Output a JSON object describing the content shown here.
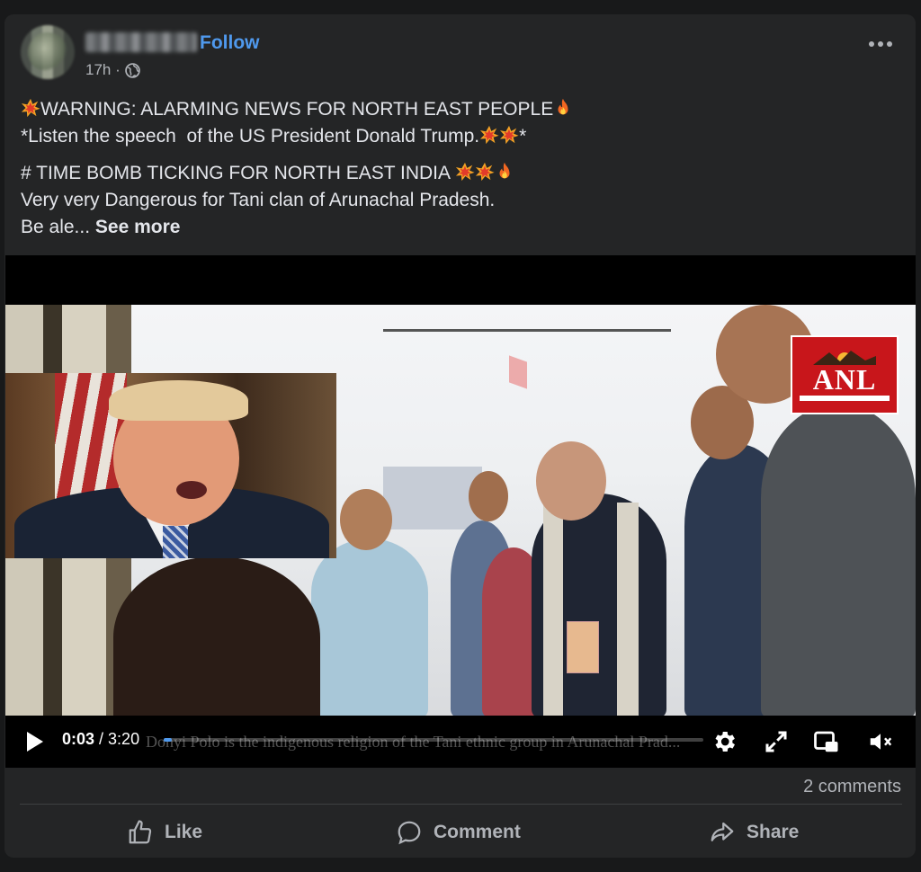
{
  "post": {
    "follow_label": "Follow",
    "time_ago": "17h ·",
    "lines": {
      "l1": "WARNING: ALARMING NEWS FOR NORTH EAST PEOPLE",
      "l2": "*Listen the speech  of the US President Donald Trump.",
      "l2_tail": "*",
      "l3": "# TIME BOMB TICKING FOR NORTH EAST INDIA ",
      "l4": "Very very Dangerous for Tani clan of Arunachal Pradesh.",
      "l5": "Be ale... "
    },
    "see_more_label": "See more"
  },
  "video": {
    "current_time": "0:03",
    "separator": " / ",
    "duration": "3:20",
    "progress_fraction": 0.015,
    "subtitle": "Donyi Polo is the indigenous religion of the Tani ethnic group in Arunachal Prad...",
    "logo_text": "ANL"
  },
  "footer": {
    "comments_count": "2 comments",
    "like_label": "Like",
    "comment_label": "Comment",
    "share_label": "Share"
  },
  "icons": {
    "globe": "globe-icon",
    "more": "more-options-icon",
    "collision": "collision-emoji-icon",
    "fire": "fire-emoji-icon",
    "play": "play-icon",
    "settings": "gear-icon",
    "fullscreen": "expand-icon",
    "pip": "picture-in-picture-icon",
    "mute": "muted-speaker-icon",
    "like": "thumbs-up-icon",
    "comment": "speech-bubble-icon",
    "share": "share-arrow-icon"
  },
  "colors": {
    "background": "#18191a",
    "card": "#242526",
    "accent": "#4f99ed",
    "text": "#e4e6eb",
    "muted": "#b0b3b8"
  }
}
